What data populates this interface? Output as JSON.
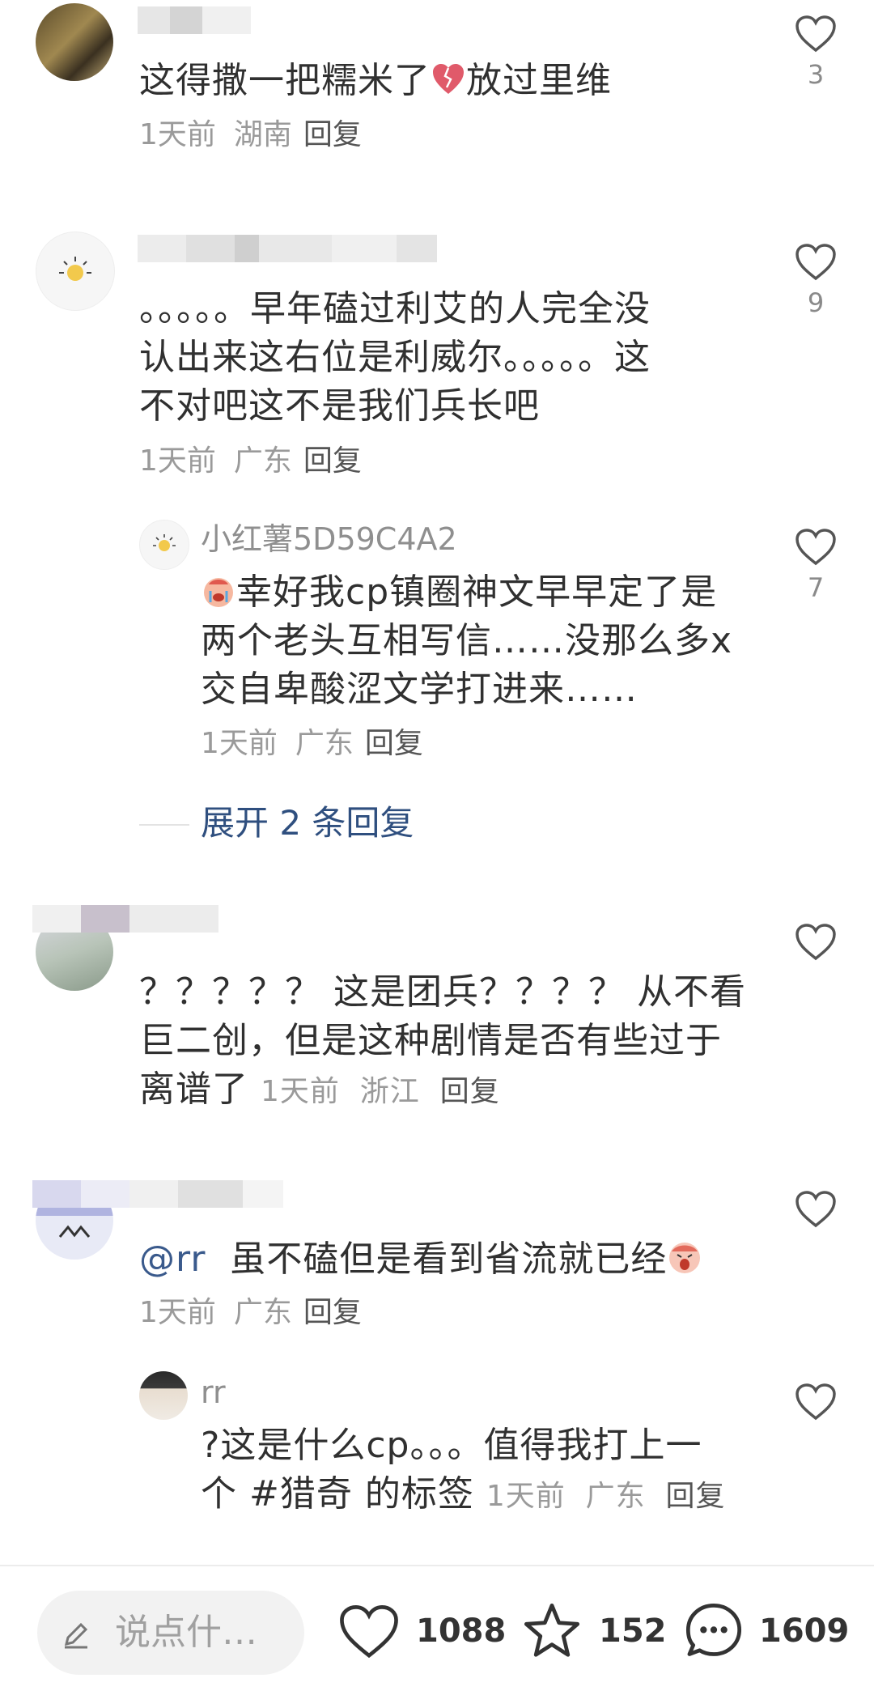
{
  "comments": [
    {
      "text": "这得撒一把糯米了",
      "text_after": "放过里维",
      "time": "1天前",
      "location": "湖南",
      "reply": "回复",
      "likes": "3"
    },
    {
      "line1": "。。。。。早年磕过利艾的人完全没",
      "line2": "认出来这右位是利威尔。。。。。这",
      "line3": "不对吧这不是我们兵长吧",
      "time": "1天前",
      "location": "广东",
      "reply": "回复",
      "likes": "9",
      "sub_reply": {
        "username": "小红薯5D59C4A2",
        "line1": "幸好我cp镇圈神文早早定了是",
        "line2": "两个老头互相写信……没那么多x",
        "line3": "交自卑酸涩文学打进来……",
        "time": "1天前",
        "location": "广东",
        "reply": "回复",
        "likes": "7"
      },
      "expand_label": "展开 2 条回复"
    },
    {
      "line1": "？？？？？ 这是团兵？？？？ 从不看",
      "line2": "巨二创，但是这种剧情是否有些过于",
      "line3": "离谱了",
      "time": "1天前",
      "location": "浙江",
      "reply": "回复"
    },
    {
      "mention": "@rr",
      "text": "虽不磕但是看到省流就已经",
      "time": "1天前",
      "location": "广东",
      "reply": "回复",
      "sub_reply": {
        "username": "rr",
        "line1": "?这是什么cp。。。值得我打上一",
        "line2": "个 #猎奇 的标签",
        "time": "1天前",
        "location": "广东",
        "reply": "回复"
      }
    }
  ],
  "bottom_bar": {
    "input_placeholder": "说点什…",
    "likes": "1088",
    "stars": "152",
    "comments": "1609"
  },
  "colors": {
    "mention": "#3a5a8c",
    "expand": "#2f4f7f",
    "meta": "#9a9a9a"
  }
}
